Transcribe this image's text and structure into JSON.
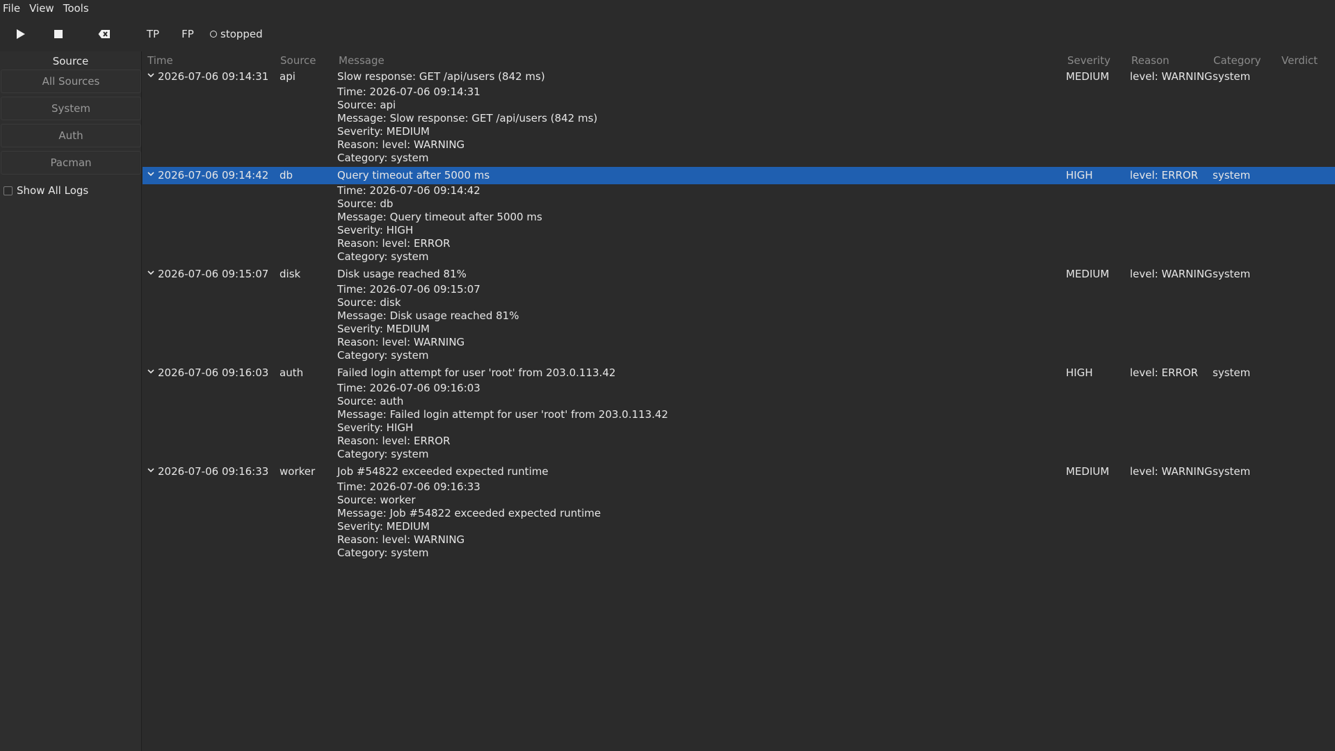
{
  "menu": [
    "File",
    "View",
    "Tools"
  ],
  "toolbar": {
    "play_icon": "play-icon",
    "stop_icon": "stop-icon",
    "clear_icon": "backspace-clear-icon",
    "tp_label": "TP",
    "fp_label": "FP",
    "status_text": "stopped"
  },
  "sidebar": {
    "header": "Source",
    "sources": [
      "All Sources",
      "System",
      "Auth",
      "Pacman"
    ],
    "show_all_label": "Show All Logs"
  },
  "table": {
    "columns": [
      "Time",
      "Source",
      "Message",
      "Severity",
      "Reason",
      "Category",
      "Verdict"
    ],
    "rows": [
      {
        "time": "2026-07-06 09:14:31",
        "source": "api",
        "message": "Slow response: GET /api/users (842 ms)",
        "severity": "MEDIUM",
        "reason": "level: WARNING",
        "category": "system",
        "selected": false,
        "details": [
          "Time: 2026-07-06 09:14:31",
          "Source: api",
          "Message: Slow response: GET /api/users (842 ms)",
          "Severity: MEDIUM",
          "Reason: level: WARNING",
          "Category: system"
        ]
      },
      {
        "time": "2026-07-06 09:14:42",
        "source": "db",
        "message": "Query timeout after 5000 ms",
        "severity": "HIGH",
        "reason": "level: ERROR",
        "category": "system",
        "selected": true,
        "details": [
          "Time: 2026-07-06 09:14:42",
          "Source: db",
          "Message: Query timeout after 5000 ms",
          "Severity: HIGH",
          "Reason: level: ERROR",
          "Category: system"
        ]
      },
      {
        "time": "2026-07-06 09:15:07",
        "source": "disk",
        "message": "Disk usage reached 81%",
        "severity": "MEDIUM",
        "reason": "level: WARNING",
        "category": "system",
        "selected": false,
        "details": [
          "Time: 2026-07-06 09:15:07",
          "Source: disk",
          "Message: Disk usage reached 81%",
          "Severity: MEDIUM",
          "Reason: level: WARNING",
          "Category: system"
        ]
      },
      {
        "time": "2026-07-06 09:16:03",
        "source": "auth",
        "message": "Failed login attempt for user 'root' from 203.0.113.42",
        "severity": "HIGH",
        "reason": "level: ERROR",
        "category": "system",
        "selected": false,
        "details": [
          "Time: 2026-07-06 09:16:03",
          "Source: auth",
          "Message: Failed login attempt for user 'root' from 203.0.113.42",
          "Severity: HIGH",
          "Reason: level: ERROR",
          "Category: system"
        ]
      },
      {
        "time": "2026-07-06 09:16:33",
        "source": "worker",
        "message": "Job #54822 exceeded expected runtime",
        "severity": "MEDIUM",
        "reason": "level: WARNING",
        "category": "system",
        "selected": false,
        "details": [
          "Time: 2026-07-06 09:16:33",
          "Source: worker",
          "Message: Job #54822 exceeded expected runtime",
          "Severity: MEDIUM",
          "Reason: level: WARNING",
          "Category: system"
        ]
      }
    ]
  },
  "colors": {
    "selection": "#1f5fb0",
    "background": "#2b2b2b",
    "sidebar": "#2e2e2e"
  }
}
